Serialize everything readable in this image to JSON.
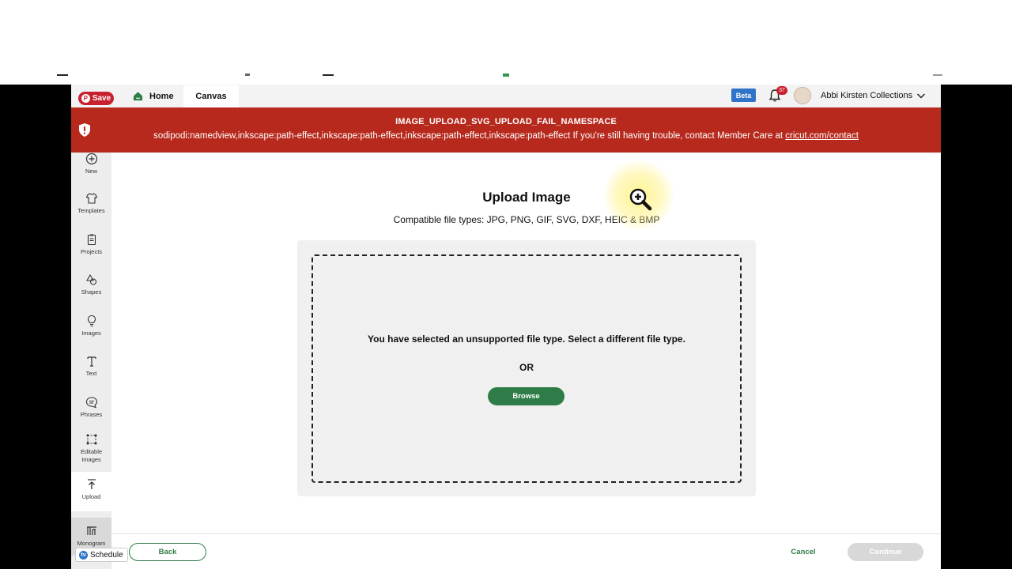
{
  "header": {
    "save_label": "Save",
    "pin_glyph": "P",
    "tabs": [
      {
        "label": "Home",
        "icon": "home-icon"
      },
      {
        "label": "Canvas"
      }
    ],
    "beta_label": "Beta",
    "notification_count": "37",
    "user_name": "Abbi Kirsten Collections"
  },
  "banner": {
    "title": "IMAGE_UPLOAD_SVG_UPLOAD_FAIL_NAMESPACE",
    "message": "sodipodi:namedview,inkscape:path-effect,inkscape:path-effect,inkscape:path-effect,inkscape:path-effect If you're still having trouble, contact Member Care at ",
    "link": "cricut.com/contact",
    "color": "#b7291d"
  },
  "sidebar": {
    "items": [
      {
        "label": "New",
        "icon": "plus-circle-icon"
      },
      {
        "label": "Templates",
        "icon": "shirt-icon"
      },
      {
        "label": "Projects",
        "icon": "clipboard-icon"
      },
      {
        "label": "Shapes",
        "icon": "shapes-icon"
      },
      {
        "label": "Images",
        "icon": "lightbulb-icon"
      },
      {
        "label": "Text",
        "icon": "text-icon"
      },
      {
        "label": "Phrases",
        "icon": "speech-bubble-icon"
      },
      {
        "label": "Editable Images",
        "icon": "editable-image-icon"
      },
      {
        "label": "Upload",
        "icon": "upload-icon"
      },
      {
        "label": "Monogram",
        "icon": "monogram-icon"
      }
    ]
  },
  "main": {
    "title": "Upload Image",
    "subtitle": "Compatible file types:  JPG, PNG, GIF, SVG, DXF, HEIC & BMP",
    "unsupported_message": "You have selected an unsupported file type. Select a different file type.",
    "or_label": "OR",
    "browse_label": "Browse"
  },
  "footer": {
    "back_label": "Back",
    "cancel_label": "Cancel",
    "continue_label": "Continue",
    "schedule_label": "Schedule",
    "schedule_icon_glyph": "tv"
  },
  "colors": {
    "accent_green": "#2e7d48",
    "error_red": "#b7291d",
    "beta_blue": "#2f74c8"
  }
}
